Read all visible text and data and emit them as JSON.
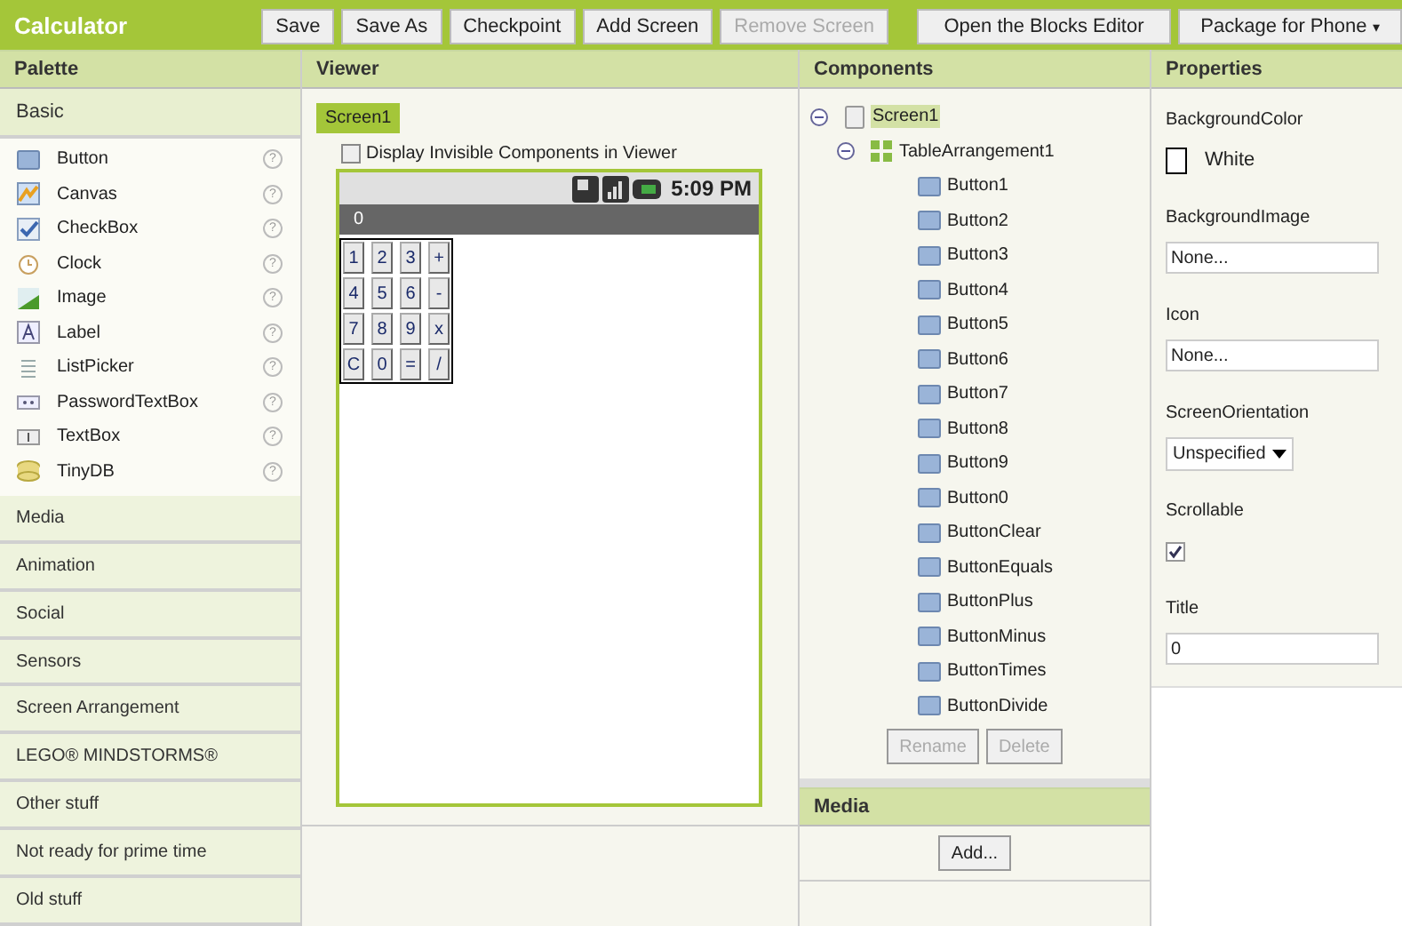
{
  "app": {
    "title": "Calculator"
  },
  "toolbar": [
    {
      "label": "Save",
      "disabled": false
    },
    {
      "label": "Save As",
      "disabled": false
    },
    {
      "label": "Checkpoint",
      "disabled": false
    },
    {
      "label": "Add Screen",
      "disabled": false
    },
    {
      "label": "Remove Screen",
      "disabled": true
    },
    {
      "label": "Open the Blocks Editor",
      "disabled": false
    },
    {
      "label": "Package for Phone",
      "caret": "▾",
      "disabled": false
    }
  ],
  "palette": {
    "title": "Palette",
    "categories": [
      {
        "label": "Basic",
        "expanded": true,
        "items": [
          {
            "label": "Button",
            "help": "?"
          },
          {
            "label": "Canvas",
            "help": "?"
          },
          {
            "label": "CheckBox",
            "help": "?"
          },
          {
            "label": "Clock",
            "help": "?"
          },
          {
            "label": "Image",
            "help": "?"
          },
          {
            "label": "Label",
            "help": "?"
          },
          {
            "label": "ListPicker",
            "help": "?"
          },
          {
            "label": "PasswordTextBox",
            "help": "?"
          },
          {
            "label": "TextBox",
            "help": "?"
          },
          {
            "label": "TinyDB",
            "help": "?"
          }
        ]
      },
      {
        "label": "Media",
        "expanded": false
      },
      {
        "label": "Animation",
        "expanded": false
      },
      {
        "label": "Social",
        "expanded": false
      },
      {
        "label": "Sensors",
        "expanded": false
      },
      {
        "label": "Screen Arrangement",
        "expanded": false
      },
      {
        "label": "LEGO® MINDSTORMS®",
        "expanded": false
      },
      {
        "label": "Other stuff",
        "expanded": false
      },
      {
        "label": "Not ready for prime time",
        "expanded": false
      },
      {
        "label": "Old stuff",
        "expanded": false
      }
    ]
  },
  "viewer": {
    "title": "Viewer",
    "screen_tabs": [
      {
        "label": "Screen1",
        "selected": true
      }
    ],
    "display_invisible": {
      "label": "Display Invisible Components in Viewer",
      "checked": false
    },
    "phone": {
      "time": "5:09 PM",
      "title": "0",
      "keys": [
        [
          "1",
          "2",
          "3",
          "+"
        ],
        [
          "4",
          "5",
          "6",
          "-"
        ],
        [
          "7",
          "8",
          "9",
          "x"
        ],
        [
          "C",
          "0",
          "=",
          "/"
        ]
      ]
    }
  },
  "components": {
    "title": "Components",
    "tree": [
      {
        "label": "Screen1",
        "selected": true,
        "expanded": true,
        "children": [
          {
            "label": "TableArrangement1",
            "selected": false,
            "expanded": true,
            "children": [
              {
                "label": "Button1",
                "selected": false
              },
              {
                "label": "Button2",
                "selected": false
              },
              {
                "label": "Button3",
                "selected": false
              },
              {
                "label": "Button4",
                "selected": false
              },
              {
                "label": "Button5",
                "selected": false
              },
              {
                "label": "Button6",
                "selected": false
              },
              {
                "label": "Button7",
                "selected": false
              },
              {
                "label": "Button8",
                "selected": false
              },
              {
                "label": "Button9",
                "selected": false
              },
              {
                "label": "Button0",
                "selected": false
              },
              {
                "label": "ButtonClear",
                "selected": false
              },
              {
                "label": "ButtonEquals",
                "selected": false
              },
              {
                "label": "ButtonPlus",
                "selected": false
              },
              {
                "label": "ButtonMinus",
                "selected": false
              },
              {
                "label": "ButtonTimes",
                "selected": false
              },
              {
                "label": "ButtonDivide",
                "selected": false
              }
            ]
          }
        ]
      }
    ],
    "buttons": [
      {
        "label": "Rename",
        "disabled": true
      },
      {
        "label": "Delete",
        "disabled": true
      }
    ]
  },
  "media": {
    "title": "Media",
    "buttons": [
      {
        "label": "Add..."
      }
    ]
  },
  "properties": {
    "title": "Properties",
    "items": [
      {
        "kind": "color",
        "label": "BackgroundColor",
        "value": "White",
        "color": "#ffffff"
      },
      {
        "kind": "text",
        "label": "BackgroundImage",
        "value": "None..."
      },
      {
        "kind": "text",
        "label": "Icon",
        "value": "None..."
      },
      {
        "kind": "dropdown",
        "label": "ScreenOrientation",
        "value": "Unspecified"
      },
      {
        "kind": "checkbox",
        "label": "Scrollable",
        "checked": true
      },
      {
        "kind": "text",
        "label": "Title",
        "value": "0"
      }
    ]
  }
}
